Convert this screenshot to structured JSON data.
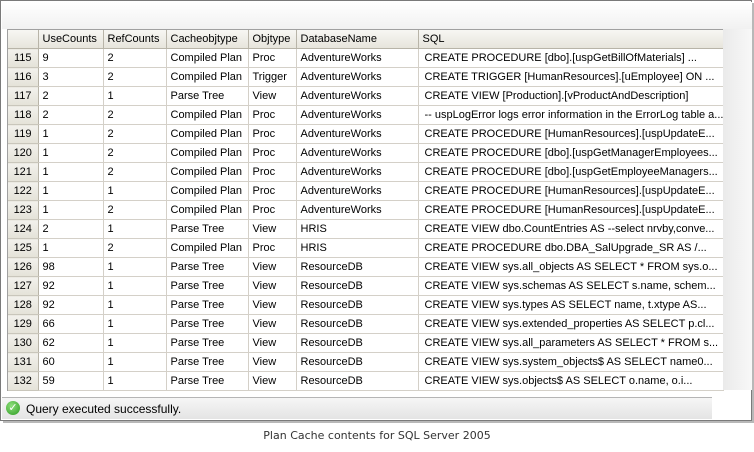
{
  "grid": {
    "columns": [
      "",
      "UseCounts",
      "RefCounts",
      "Cacheobjtype",
      "Objtype",
      "DatabaseName",
      "SQL"
    ],
    "rows": [
      {
        "n": "115",
        "usecounts": "9",
        "refcounts": "2",
        "cacheobjtype": "Compiled Plan",
        "objtype": "Proc",
        "db": "AdventureWorks",
        "sql": "CREATE PROCEDURE [dbo].[uspGetBillOfMaterials]     ..."
      },
      {
        "n": "116",
        "usecounts": "3",
        "refcounts": "2",
        "cacheobjtype": "Compiled Plan",
        "objtype": "Trigger",
        "db": "AdventureWorks",
        "sql": "CREATE TRIGGER [HumanResources].[uEmployee] ON ..."
      },
      {
        "n": "117",
        "usecounts": "2",
        "refcounts": "1",
        "cacheobjtype": "Parse Tree",
        "objtype": "View",
        "db": "AdventureWorks",
        "sql": "CREATE VIEW [Production].[vProductAndDescription]"
      },
      {
        "n": "118",
        "usecounts": "2",
        "refcounts": "2",
        "cacheobjtype": "Compiled Plan",
        "objtype": "Proc",
        "db": "AdventureWorks",
        "sql": "-- uspLogError logs error information in the ErrorLog table a..."
      },
      {
        "n": "119",
        "usecounts": "1",
        "refcounts": "2",
        "cacheobjtype": "Compiled Plan",
        "objtype": "Proc",
        "db": "AdventureWorks",
        "sql": "CREATE PROCEDURE [HumanResources].[uspUpdateE..."
      },
      {
        "n": "120",
        "usecounts": "1",
        "refcounts": "2",
        "cacheobjtype": "Compiled Plan",
        "objtype": "Proc",
        "db": "AdventureWorks",
        "sql": "CREATE PROCEDURE [dbo].[uspGetManagerEmployees..."
      },
      {
        "n": "121",
        "usecounts": "1",
        "refcounts": "2",
        "cacheobjtype": "Compiled Plan",
        "objtype": "Proc",
        "db": "AdventureWorks",
        "sql": "CREATE PROCEDURE [dbo].[uspGetEmployeeManagers..."
      },
      {
        "n": "122",
        "usecounts": "1",
        "refcounts": "1",
        "cacheobjtype": "Compiled Plan",
        "objtype": "Proc",
        "db": "AdventureWorks",
        "sql": "CREATE PROCEDURE [HumanResources].[uspUpdateE..."
      },
      {
        "n": "123",
        "usecounts": "1",
        "refcounts": "2",
        "cacheobjtype": "Compiled Plan",
        "objtype": "Proc",
        "db": "AdventureWorks",
        "sql": "CREATE PROCEDURE [HumanResources].[uspUpdateE..."
      },
      {
        "n": "124",
        "usecounts": "2",
        "refcounts": "1",
        "cacheobjtype": "Parse Tree",
        "objtype": "View",
        "db": "HRIS",
        "sql": "CREATE VIEW dbo.CountEntries  AS  --select nrvby,conve..."
      },
      {
        "n": "125",
        "usecounts": "1",
        "refcounts": "2",
        "cacheobjtype": "Compiled Plan",
        "objtype": "Proc",
        "db": "HRIS",
        "sql": "CREATE PROCEDURE dbo.DBA_SalUpgrade_SR   AS  /..."
      },
      {
        "n": "126",
        "usecounts": "98",
        "refcounts": "1",
        "cacheobjtype": "Parse Tree",
        "objtype": "View",
        "db": "ResourceDB",
        "sql": "CREATE VIEW sys.all_objects AS   SELECT * FROM sys.o..."
      },
      {
        "n": "127",
        "usecounts": "92",
        "refcounts": "1",
        "cacheobjtype": "Parse Tree",
        "objtype": "View",
        "db": "ResourceDB",
        "sql": "CREATE VIEW sys.schemas AS   SELECT s.name, schem..."
      },
      {
        "n": "128",
        "usecounts": "92",
        "refcounts": "1",
        "cacheobjtype": "Parse Tree",
        "objtype": "View",
        "db": "ResourceDB",
        "sql": "CREATE VIEW sys.types AS   SELECT name,    t.xtype AS..."
      },
      {
        "n": "129",
        "usecounts": "66",
        "refcounts": "1",
        "cacheobjtype": "Parse Tree",
        "objtype": "View",
        "db": "ResourceDB",
        "sql": "CREATE VIEW sys.extended_properties AS   SELECT p.cl..."
      },
      {
        "n": "130",
        "usecounts": "62",
        "refcounts": "1",
        "cacheobjtype": "Parse Tree",
        "objtype": "View",
        "db": "ResourceDB",
        "sql": "CREATE VIEW sys.all_parameters AS   SELECT * FROM s..."
      },
      {
        "n": "131",
        "usecounts": "60",
        "refcounts": "1",
        "cacheobjtype": "Parse Tree",
        "objtype": "View",
        "db": "ResourceDB",
        "sql": "CREATE VIEW sys.system_objects$ AS   SELECT name0..."
      },
      {
        "n": "132",
        "usecounts": "59",
        "refcounts": "1",
        "cacheobjtype": "Parse Tree",
        "objtype": "View",
        "db": "ResourceDB",
        "sql": "CREATE VIEW sys.objects$ AS   SELECT    o.name,    o.i..."
      }
    ]
  },
  "status": {
    "icon": "success-check-icon",
    "icon_glyph": "✓",
    "text": "Query executed successfully.",
    "color": "#2b9a1f"
  },
  "caption": "Plan Cache contents for SQL Server 2005"
}
